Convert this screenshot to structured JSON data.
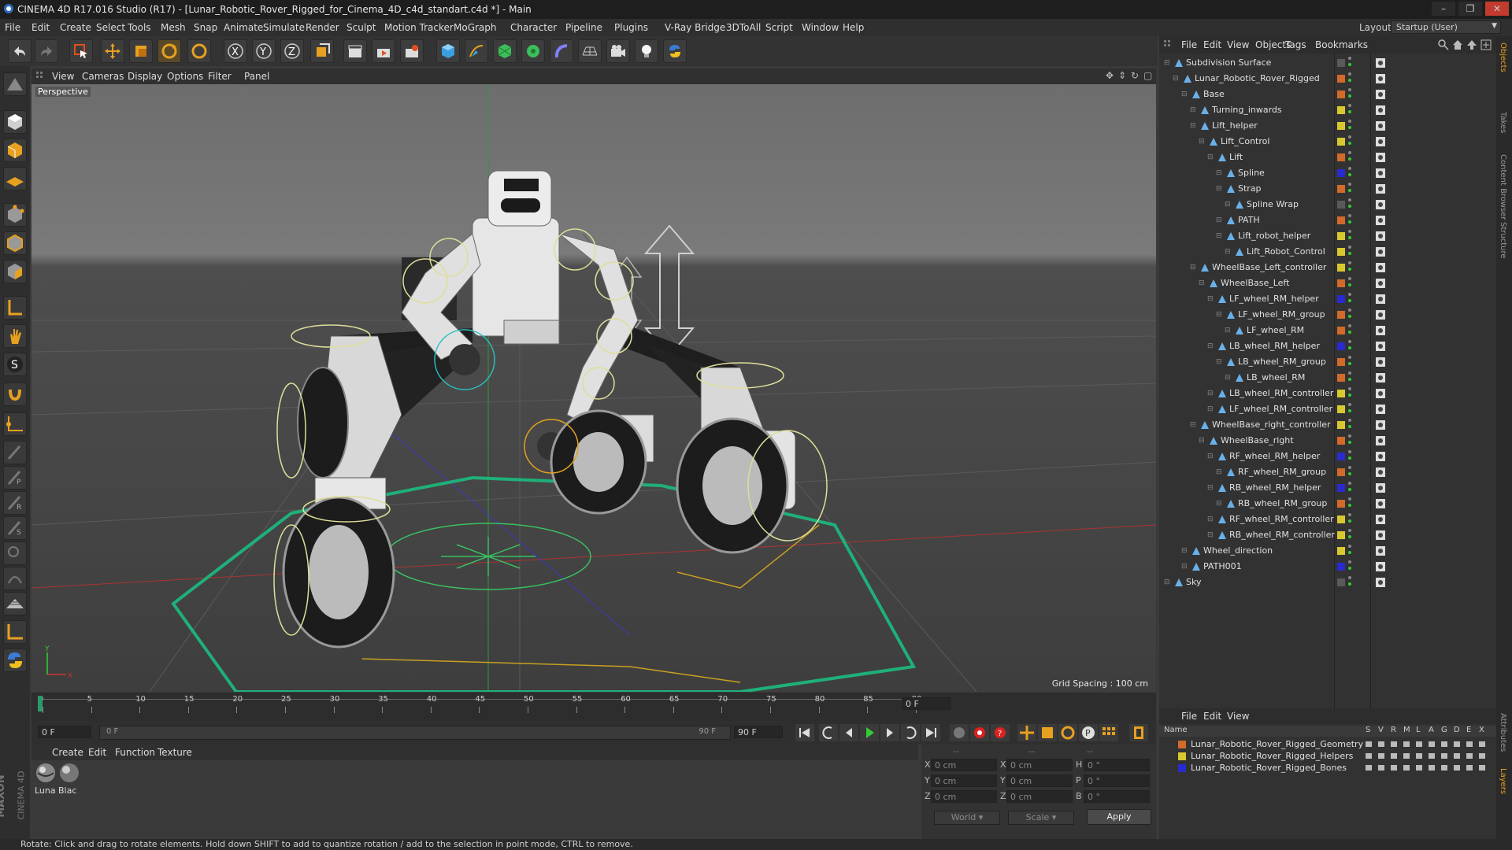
{
  "window": {
    "title": "CINEMA 4D R17.016 Studio (R17) - [Lunar_Robotic_Rover_Rigged_for_Cinema_4D_c4d_standart.c4d *] - Main"
  },
  "menubar": [
    "File",
    "Edit",
    "Create",
    "Select",
    "Tools",
    "Mesh",
    "Snap",
    "Animate",
    "Simulate",
    "Render",
    "Sculpt",
    "Motion Tracker",
    "MoGraph",
    "Character",
    "Pipeline",
    "Plugins",
    "V-Ray Bridge",
    "3DToAll",
    "Script",
    "Window",
    "Help"
  ],
  "layout": {
    "label": "Layout:",
    "value": "Startup (User)"
  },
  "viewport": {
    "menu": [
      "View",
      "Cameras",
      "Display",
      "Options",
      "Filter",
      "Panel"
    ],
    "label": "Perspective",
    "grid_spacing": "Grid Spacing : 100 cm"
  },
  "timeline": {
    "ticks": [
      "0",
      "5",
      "10",
      "15",
      "20",
      "25",
      "30",
      "35",
      "40",
      "45",
      "50",
      "55",
      "60",
      "65",
      "70",
      "75",
      "80",
      "85",
      "90"
    ],
    "frame_field": "0 F"
  },
  "transport": {
    "start": "0 F",
    "slider_start": "0 F",
    "slider_end": "90 F",
    "end": "90 F"
  },
  "materials": {
    "menu": [
      "Create",
      "Edit",
      "Function",
      "Texture"
    ],
    "items": [
      {
        "label": "Luna"
      },
      {
        "label": "Blac"
      }
    ]
  },
  "coords": {
    "header": [
      "--",
      "--",
      "--"
    ],
    "rows": [
      {
        "a": "X",
        "av": "0 cm",
        "b": "X",
        "bv": "0 cm",
        "c": "H",
        "cv": "0 °"
      },
      {
        "a": "Y",
        "av": "0 cm",
        "b": "Y",
        "bv": "0 cm",
        "c": "P",
        "cv": "0 °"
      },
      {
        "a": "Z",
        "av": "0 cm",
        "b": "Z",
        "bv": "0 cm",
        "c": "B",
        "cv": "0 °"
      }
    ],
    "world": "World",
    "scale": "Scale",
    "apply": "Apply"
  },
  "objects": {
    "menu": [
      "File",
      "Edit",
      "View",
      "Objects",
      "Tags",
      "Bookmarks"
    ],
    "rows": [
      {
        "label": "Subdivision Surface",
        "indent": 0,
        "color": "#5a5a5a"
      },
      {
        "label": "Lunar_Robotic_Rover_Rigged",
        "indent": 1,
        "color": "#d26a2a"
      },
      {
        "label": "Base",
        "indent": 2,
        "color": "#d26a2a"
      },
      {
        "label": "Turning_inwards",
        "indent": 3,
        "color": "#d8c830"
      },
      {
        "label": "Lift_helper",
        "indent": 3,
        "color": "#d8c830"
      },
      {
        "label": "Lift_Control",
        "indent": 4,
        "color": "#d8c830"
      },
      {
        "label": "Lift",
        "indent": 5,
        "color": "#d26a2a"
      },
      {
        "label": "Spline",
        "indent": 6,
        "color": "#2a2ad0"
      },
      {
        "label": "Strap",
        "indent": 6,
        "color": "#d26a2a"
      },
      {
        "label": "Spline Wrap",
        "indent": 7,
        "color": "#5a5a5a"
      },
      {
        "label": "PATH",
        "indent": 6,
        "color": "#d26a2a"
      },
      {
        "label": "Lift_robot_helper",
        "indent": 6,
        "color": "#d8c830"
      },
      {
        "label": "Lift_Robot_Control",
        "indent": 7,
        "color": "#d8c830"
      },
      {
        "label": "WheelBase_Left_controller",
        "indent": 3,
        "color": "#d8c830"
      },
      {
        "label": "WheelBase_Left",
        "indent": 4,
        "color": "#d26a2a"
      },
      {
        "label": "LF_wheel_RM_helper",
        "indent": 5,
        "color": "#2a2ad0"
      },
      {
        "label": "LF_wheel_RM_group",
        "indent": 6,
        "color": "#d26a2a"
      },
      {
        "label": "LF_wheel_RM",
        "indent": 7,
        "color": "#d26a2a"
      },
      {
        "label": "LB_wheel_RM_helper",
        "indent": 5,
        "color": "#2a2ad0"
      },
      {
        "label": "LB_wheel_RM_group",
        "indent": 6,
        "color": "#d26a2a"
      },
      {
        "label": "LB_wheel_RM",
        "indent": 7,
        "color": "#d26a2a"
      },
      {
        "label": "LB_wheel_RM_controller",
        "indent": 5,
        "color": "#d8c830"
      },
      {
        "label": "LF_wheel_RM_controller",
        "indent": 5,
        "color": "#d8c830"
      },
      {
        "label": "WheelBase_right_controller",
        "indent": 3,
        "color": "#d8c830"
      },
      {
        "label": "WheelBase_right",
        "indent": 4,
        "color": "#d26a2a"
      },
      {
        "label": "RF_wheel_RM_helper",
        "indent": 5,
        "color": "#2a2ad0"
      },
      {
        "label": "RF_wheel_RM_group",
        "indent": 6,
        "color": "#d26a2a"
      },
      {
        "label": "RB_wheel_RM_helper",
        "indent": 5,
        "color": "#2a2ad0"
      },
      {
        "label": "RB_wheel_RM_group",
        "indent": 6,
        "color": "#d26a2a"
      },
      {
        "label": "RF_wheel_RM_controller",
        "indent": 5,
        "color": "#d8c830"
      },
      {
        "label": "RB_wheel_RM_controller",
        "indent": 5,
        "color": "#d8c830"
      },
      {
        "label": "Wheel_direction",
        "indent": 2,
        "color": "#d8c830"
      },
      {
        "label": "PATH001",
        "indent": 2,
        "color": "#2a2ad0"
      },
      {
        "label": "Sky",
        "indent": 0,
        "color": "#5a5a5a"
      }
    ]
  },
  "layers": {
    "menu": [
      "File",
      "Edit",
      "View"
    ],
    "header": {
      "name": "Name",
      "cols": [
        "S",
        "V",
        "R",
        "M",
        "L",
        "A",
        "G",
        "D",
        "E",
        "X"
      ]
    },
    "rows": [
      {
        "label": "Lunar_Robotic_Rover_Rigged_Geometry",
        "color": "#d26a2a"
      },
      {
        "label": "Lunar_Robotic_Rover_Rigged_Helpers",
        "color": "#d8c830"
      },
      {
        "label": "Lunar_Robotic_Rover_Rigged_Bones",
        "color": "#2a2ad0"
      }
    ]
  },
  "side_tabs": [
    "Objects",
    "Takes",
    "Content Browser",
    "Structure"
  ],
  "side_tabs_bottom": [
    "Attributes",
    "Layers"
  ],
  "brand": [
    "MAXON",
    "CINEMA 4D"
  ],
  "status": "Rotate: Click and drag to rotate elements. Hold down SHIFT to add to quantize rotation / add to the selection in point mode, CTRL to remove."
}
